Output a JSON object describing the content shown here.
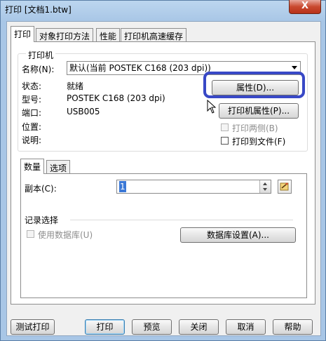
{
  "window": {
    "title": "打印 [文档1.btw]",
    "close_label": "X"
  },
  "tabs": [
    {
      "label": "打印"
    },
    {
      "label": "对象打印方法"
    },
    {
      "label": "性能"
    },
    {
      "label": "打印机高速缓存"
    }
  ],
  "printer": {
    "group_label": "打印机",
    "name_label": "名称(N):",
    "name_value": "默认(当前 POSTEK C168 (203 dpi))",
    "properties_button": "属性(D)...",
    "printer_properties_button": "打印机属性(P)...",
    "status_label": "状态:",
    "status_value": "就绪",
    "model_label": "型号:",
    "model_value": "POSTEK C168 (203 dpi)",
    "port_label": "端口:",
    "port_value": "USB005",
    "location_label": "位置:",
    "comment_label": "说明:",
    "duplex_label": "打印两侧(B)",
    "print_to_file_label": "打印到文件(F)"
  },
  "subtabs": [
    {
      "label": "数量"
    },
    {
      "label": "选项"
    }
  ],
  "quantity": {
    "copies_label": "副本(C):",
    "copies_value": "1"
  },
  "record_selection": {
    "group_label": "记录选择",
    "use_database_label": "使用数据库(U)",
    "database_settings_button": "数据库设置(A)..."
  },
  "footer": {
    "test_print": "测试打印",
    "print": "打印",
    "preview": "预览",
    "close": "关闭",
    "cancel": "取消",
    "help": "帮助"
  }
}
